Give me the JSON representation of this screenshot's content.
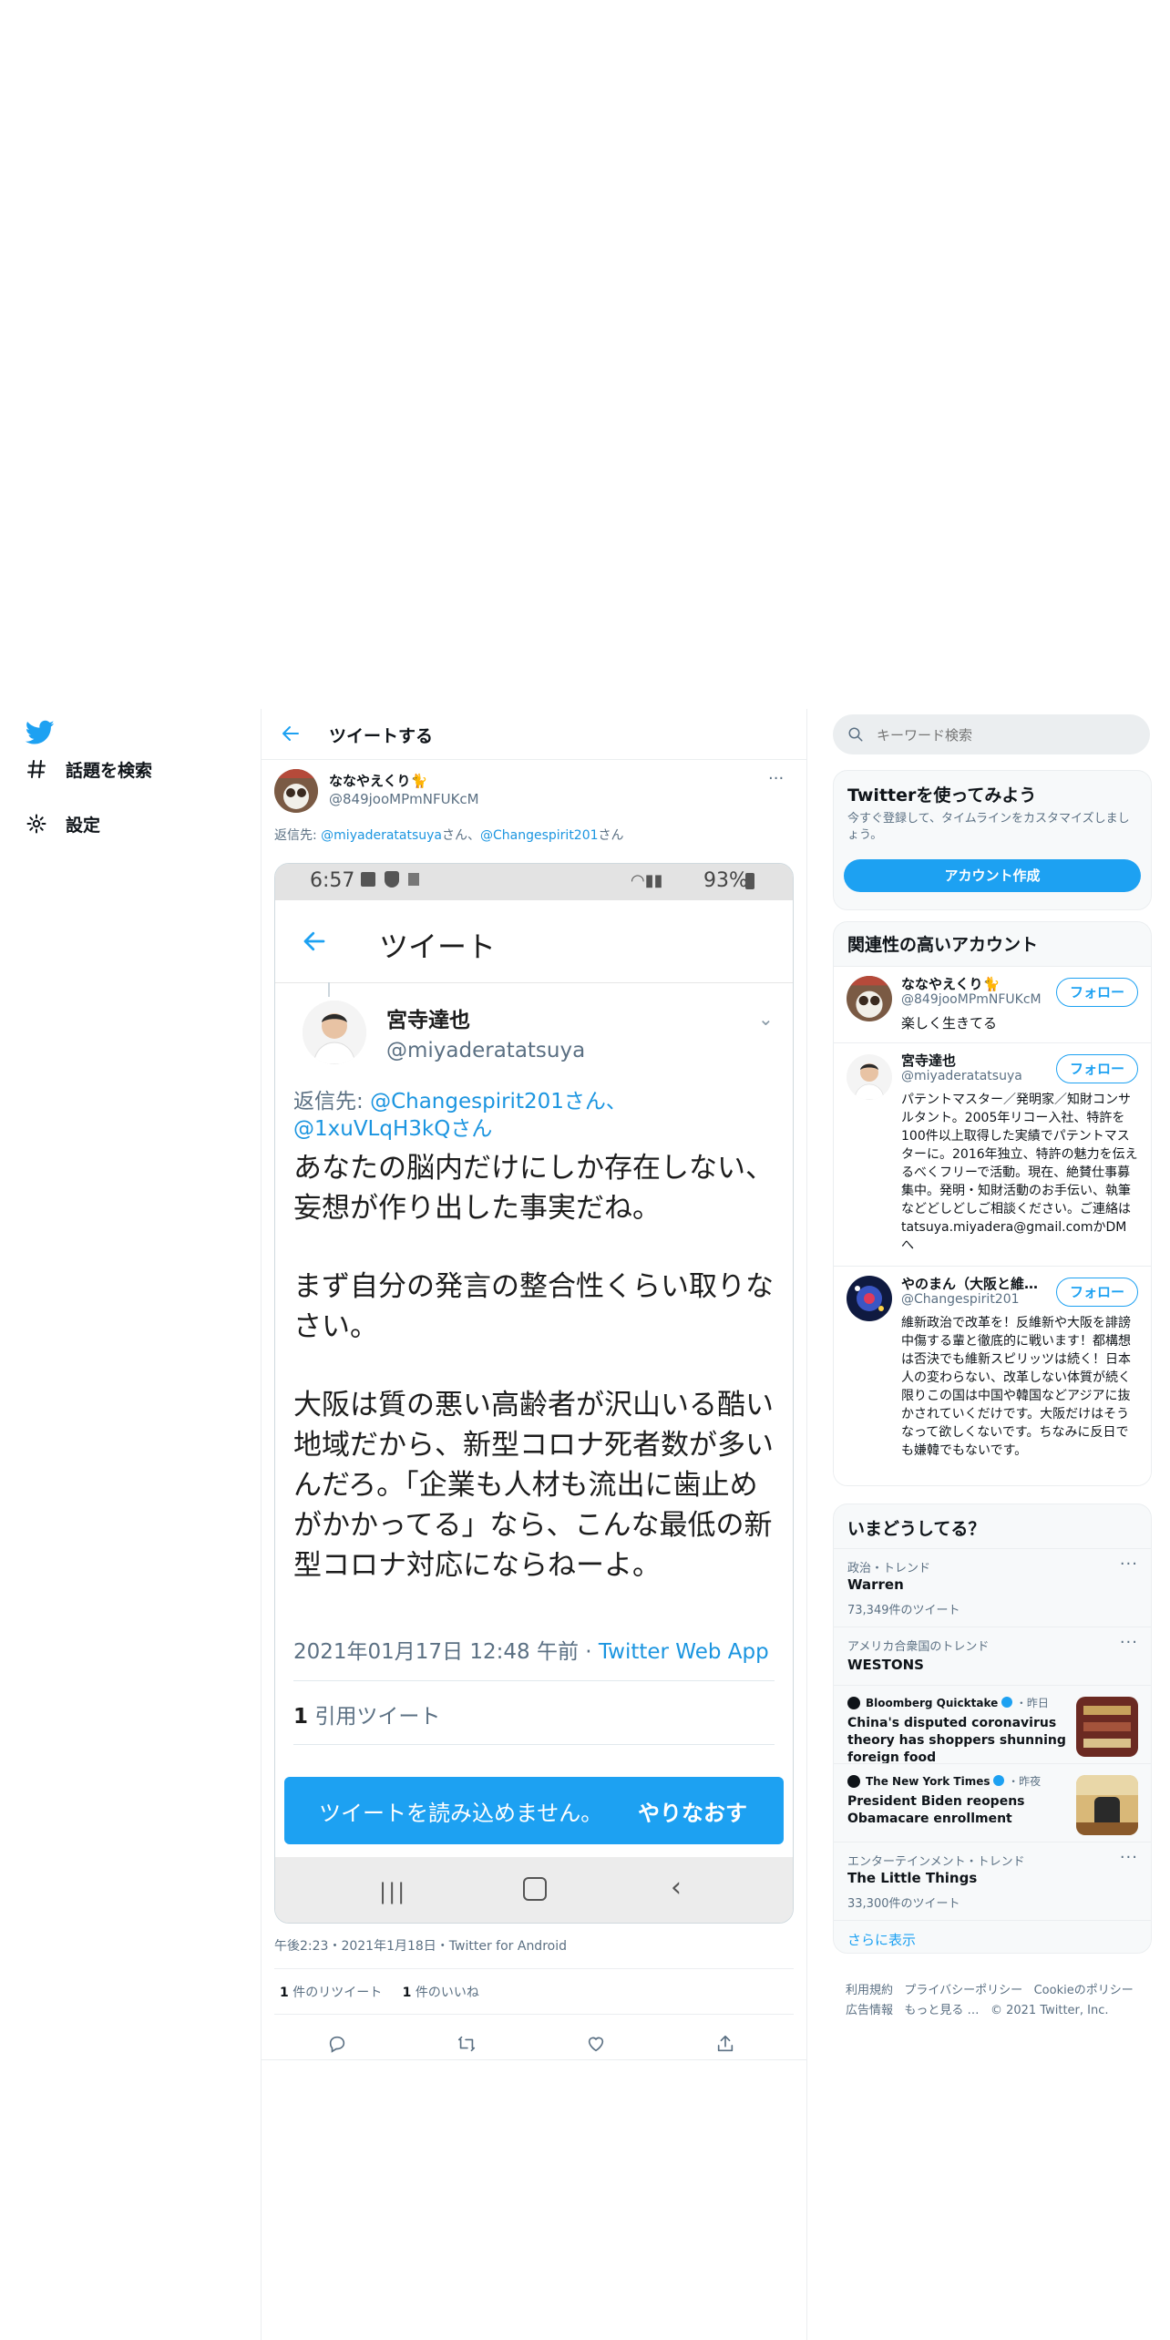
{
  "nav": {
    "items": [
      {
        "label": "話題を検索",
        "icon": "hashtag-icon"
      },
      {
        "label": "設定",
        "icon": "gear-icon"
      }
    ]
  },
  "header": {
    "title": "ツイートする"
  },
  "tweet": {
    "display_name": "ななやえくり🐈",
    "handle": "@849jooMPmNFUKcM",
    "reply_prefix": "返信先: ",
    "reply_user1": "@miyaderatatsuya",
    "reply_sep1": "さん、",
    "reply_user2": "@Changespirit201",
    "reply_sep2": "さん",
    "timestamp": "午後2:23・2021年1月18日・Twitter for Android",
    "retweets_count": "1",
    "retweets_label": " 件のリツイート",
    "likes_count": "1",
    "likes_label": " 件のいいね"
  },
  "screenshot": {
    "status_time": "6:57",
    "status_battery": "93%",
    "appbar_title": "ツイート",
    "author_name": "宮寺達也",
    "author_handle": "@miyaderatatsuya",
    "reply_prefix": "返信先: ",
    "reply_users": "@Changespirit201さん、@1xuVLqH3kQさん",
    "paragraph1": "あなたの脳内だけにしか存在しない、妄想が作り出した事実だね。",
    "paragraph2": "まず自分の発言の整合性くらい取りなさい。",
    "paragraph3": "大阪は質の悪い高齢者が沢山いる酷い地域だから、新型コロナ死者数が多いんだろ。「企業も人材も流出に歯止めがかかってる」なら、こんな最低の新型コロナ対応にならねーよ。",
    "date": "2021年01月17日 12:48 午前 · ",
    "source": "Twitter Web App",
    "quote_count": "1",
    "quote_label": " 引用ツイート",
    "toast_text": "ツイートを読み込めません。",
    "toast_action": "やりなおす"
  },
  "search": {
    "placeholder": "キーワード検索"
  },
  "signup": {
    "title": "Twitterを使ってみよう",
    "text": "今すぐ登録して、タイムラインをカスタマイズしましょう。",
    "button": "アカウント作成"
  },
  "related": {
    "title": "関連性の高いアカウント",
    "follow_label": "フォロー",
    "accounts": [
      {
        "name": "ななやえくり🐈",
        "handle": "@849jooMPmNFUKcM",
        "bio": "楽しく生きてる"
      },
      {
        "name": "宮寺達也",
        "handle": "@miyaderatatsuya",
        "bio": "パテントマスター／発明家／知財コンサルタント。2005年リコー入社、特許を100件以上取得した実績でパテントマスターに。2016年独立、特許の魅力を伝えるべくフリーで活動。現在、絶賛仕事募集中。発明・知財活動のお手伝い、執筆などどしどしご相談ください。ご連絡は tatsuya.miyadera@gmail.comかDMへ"
      },
      {
        "name": "やのまん（大阪と維…",
        "handle": "@Changespirit201",
        "bio": "維新政治で改革を！反維新や大阪を誹謗中傷する輩と徹底的に戦います！都構想は否決でも維新スピリッツは続く！日本人の変わらない、改革しない体質が続く限りこの国は中国や韓国などアジアに抜かされていくだけです。大阪だけはそうなって欲しくないです。ちなみに反日でも嫌韓でもないです。"
      }
    ]
  },
  "trends": {
    "title": "いまどうしてる？",
    "items": [
      {
        "meta": "政治・トレンド",
        "name": "Warren",
        "count": "73,349件のツイート"
      },
      {
        "meta": "アメリカ合衆国のトレンド",
        "name": "WESTONS"
      },
      {
        "source": "Bloomberg Quicktake",
        "time": "・昨日",
        "headline": "China's disputed coronavirus theory has shoppers shunning foreign food"
      },
      {
        "source": "The New York Times",
        "time": "・昨夜",
        "headline": "President Biden reopens Obamacare enrollment"
      },
      {
        "meta": "エンターテインメント・トレンド",
        "name": "The Little Things",
        "count": "33,300件のツイート"
      }
    ],
    "show_more": "さらに表示"
  },
  "footer": {
    "links": [
      "利用規約",
      "プライバシーポリシー",
      "Cookieのポリシー",
      "広告情報",
      "もっと見る …"
    ],
    "copyright": "© 2021 Twitter, Inc."
  },
  "colors": {
    "accent": "#1da1f2",
    "link": "#1b95e0",
    "text": "#0f1419",
    "muted": "#5b7083"
  }
}
